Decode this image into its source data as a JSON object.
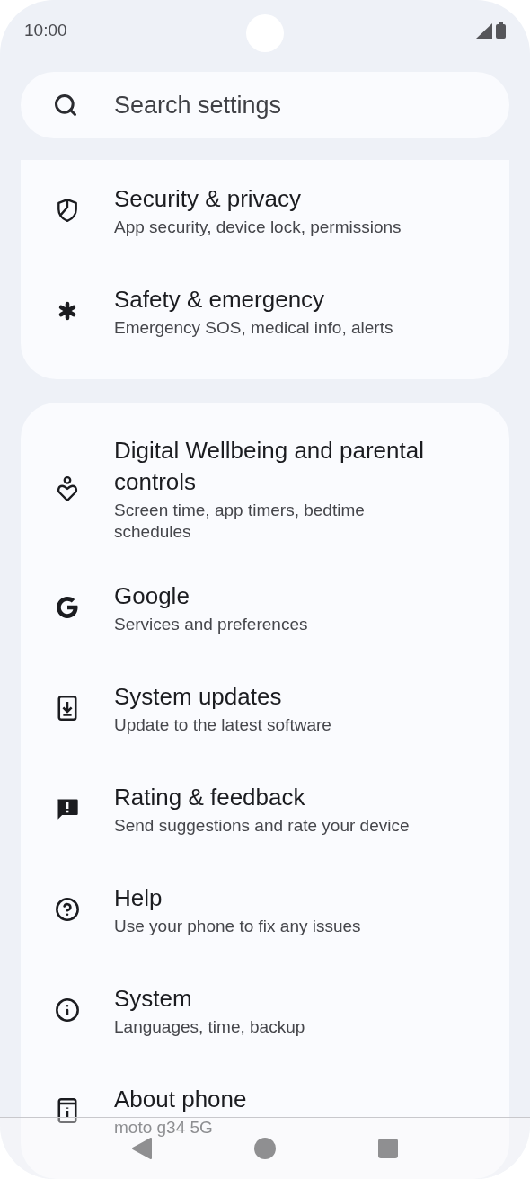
{
  "status_bar": {
    "time": "10:00"
  },
  "search": {
    "placeholder": "Search settings"
  },
  "groups": [
    {
      "items": [
        {
          "title": "Security & privacy",
          "subtitle": "App security, device lock, permissions"
        },
        {
          "title": "Safety & emergency",
          "subtitle": "Emergency SOS, medical info, alerts"
        }
      ]
    },
    {
      "items": [
        {
          "title": "Digital Wellbeing and parental controls",
          "subtitle": "Screen time, app timers, bedtime schedules"
        },
        {
          "title": "Google",
          "subtitle": "Services and preferences"
        },
        {
          "title": "System updates",
          "subtitle": "Update to the latest software"
        },
        {
          "title": "Rating & feedback",
          "subtitle": "Send suggestions and rate your device"
        },
        {
          "title": "Help",
          "subtitle": "Use your phone to fix any issues"
        },
        {
          "title": "System",
          "subtitle": "Languages, time, backup"
        },
        {
          "title": "About phone",
          "subtitle": "moto g34 5G"
        }
      ]
    }
  ]
}
